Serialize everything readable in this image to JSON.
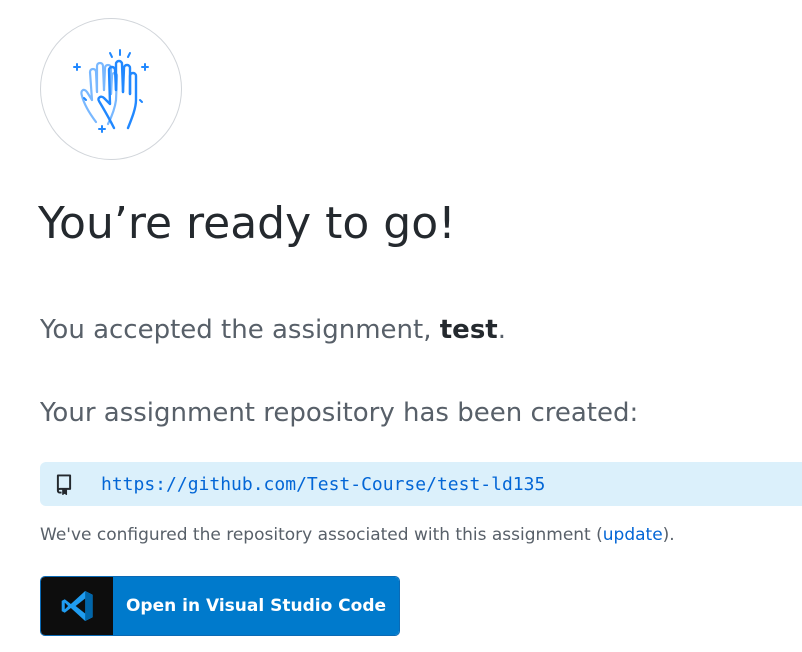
{
  "page": {
    "title": "You’re ready to go!",
    "accepted_prefix": "You accepted the assignment, ",
    "assignment_name": "test",
    "accepted_suffix": ".",
    "repo_created_text": "Your assignment repository has been created:",
    "repo_url": "https://github.com/Test-Course/test-ld135",
    "configured_prefix": "We've configured the repository associated with this assignment (",
    "update_link": "update",
    "configured_suffix": ")."
  },
  "buttons": {
    "open_vscode": "Open in Visual Studio Code"
  },
  "icons": {
    "hero": "high-five-hands-icon",
    "repo": "repo-icon",
    "vscode": "vscode-logo-icon"
  },
  "colors": {
    "link": "#0366d6",
    "repo_box_bg": "#dbf0fb",
    "vscode_blue": "#007acc",
    "hero_icon": "#2188ff"
  }
}
